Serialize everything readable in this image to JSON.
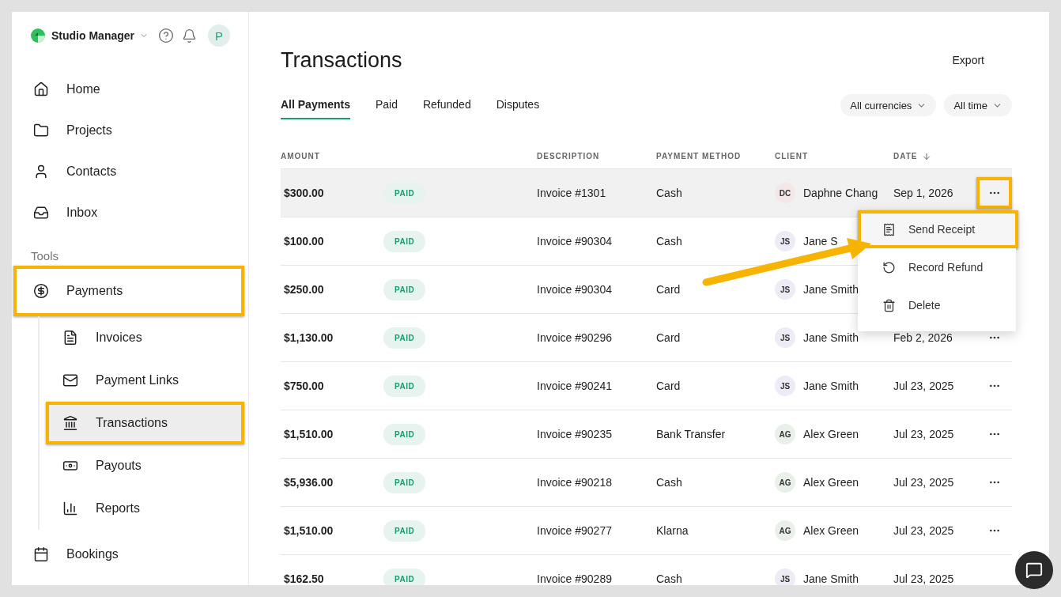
{
  "app": {
    "name": "Studio Manager",
    "avatar": "P"
  },
  "nav": [
    {
      "label": "Home",
      "selected": false
    },
    {
      "label": "Projects",
      "selected": false
    },
    {
      "label": "Contacts",
      "selected": false
    },
    {
      "label": "Inbox",
      "selected": false
    }
  ],
  "section_label": "Tools",
  "tools": [
    {
      "label": "Payments",
      "selected": false,
      "highlighted": true,
      "children": [
        {
          "label": "Invoices",
          "selected": false,
          "highlighted": false
        },
        {
          "label": "Payment Links",
          "selected": false,
          "highlighted": false
        },
        {
          "label": "Transactions",
          "selected": true,
          "highlighted": true
        },
        {
          "label": "Payouts",
          "selected": false,
          "highlighted": false
        },
        {
          "label": "Reports",
          "selected": false,
          "highlighted": false
        }
      ]
    },
    {
      "label": "Bookings",
      "selected": false,
      "highlighted": false
    }
  ],
  "page": {
    "title": "Transactions",
    "export": "Export"
  },
  "tabs": [
    {
      "label": "All Payments",
      "selected": true
    },
    {
      "label": "Paid",
      "selected": false
    },
    {
      "label": "Refunded",
      "selected": false
    },
    {
      "label": "Disputes",
      "selected": false
    }
  ],
  "filters": [
    "All currencies",
    "All time"
  ],
  "columns": [
    {
      "label": "AMOUNT",
      "sorted": false
    },
    {
      "label": "DESCRIPTION",
      "sorted": false
    },
    {
      "label": "PAYMENT METHOD",
      "sorted": false
    },
    {
      "label": "CLIENT",
      "sorted": false
    },
    {
      "label": "DATE",
      "sorted": true
    }
  ],
  "rows": [
    {
      "amount": "$300.00",
      "status": "PAID",
      "description": "Invoice #1301",
      "method": "Cash",
      "client": {
        "initials": "DC",
        "name": "Daphne Chang",
        "color": "#f3e7e7"
      },
      "date": "Sep 1, 2026",
      "actions": true,
      "selected": true,
      "highlighted": true
    },
    {
      "amount": "$100.00",
      "status": "PAID",
      "description": "Invoice #90304",
      "method": "Cash",
      "client": {
        "initials": "JS",
        "name": "Jane S",
        "color": "#ecebf6"
      },
      "actions": false,
      "selected": false
    },
    {
      "amount": "$250.00",
      "status": "PAID",
      "description": "Invoice #90304",
      "method": "Card",
      "client": {
        "initials": "JS",
        "name": "Jane Smith",
        "color": "#ecebf6"
      },
      "actions": false,
      "selected": false
    },
    {
      "amount": "$1,130.00",
      "status": "PAID",
      "description": "Invoice #90296",
      "method": "Card",
      "client": {
        "initials": "JS",
        "name": "Jane Smith",
        "color": "#ecebf6"
      },
      "date": "Feb 2, 2026",
      "actions": true,
      "selected": false,
      "highlighted": false
    },
    {
      "amount": "$750.00",
      "status": "PAID",
      "description": "Invoice #90241",
      "method": "Card",
      "client": {
        "initials": "JS",
        "name": "Jane Smith",
        "color": "#ecebf6"
      },
      "date": "Jul 23, 2025",
      "actions": true,
      "selected": false,
      "highlighted": false
    },
    {
      "amount": "$1,510.00",
      "status": "PAID",
      "description": "Invoice #90235",
      "method": "Bank Transfer",
      "client": {
        "initials": "AG",
        "name": "Alex Green",
        "color": "#e9efe9"
      },
      "date": "Jul 23, 2025",
      "actions": true,
      "selected": false,
      "highlighted": false
    },
    {
      "amount": "$5,936.00",
      "status": "PAID",
      "description": "Invoice #90218",
      "method": "Cash",
      "client": {
        "initials": "AG",
        "name": "Alex Green",
        "color": "#e9efe9"
      },
      "date": "Jul 23, 2025",
      "actions": true,
      "selected": false,
      "highlighted": false
    },
    {
      "amount": "$1,510.00",
      "status": "PAID",
      "description": "Invoice #90277",
      "method": "Klarna",
      "client": {
        "initials": "AG",
        "name": "Alex Green",
        "color": "#e9efe9"
      },
      "date": "Jul 23, 2025",
      "actions": true,
      "selected": false,
      "highlighted": false
    },
    {
      "amount": "$162.50",
      "status": "PAID",
      "description": "Invoice #90289",
      "method": "Cash",
      "client": {
        "initials": "JS",
        "name": "Jane Smith",
        "color": "#ecebf6"
      },
      "date": "Jul 23, 2025",
      "actions": false,
      "selected": false
    }
  ],
  "menu": [
    {
      "label": "Send Receipt",
      "highlighted": true
    },
    {
      "label": "Record Refund",
      "highlighted": false
    },
    {
      "label": "Delete",
      "highlighted": false
    }
  ],
  "callout_arrow": true
}
